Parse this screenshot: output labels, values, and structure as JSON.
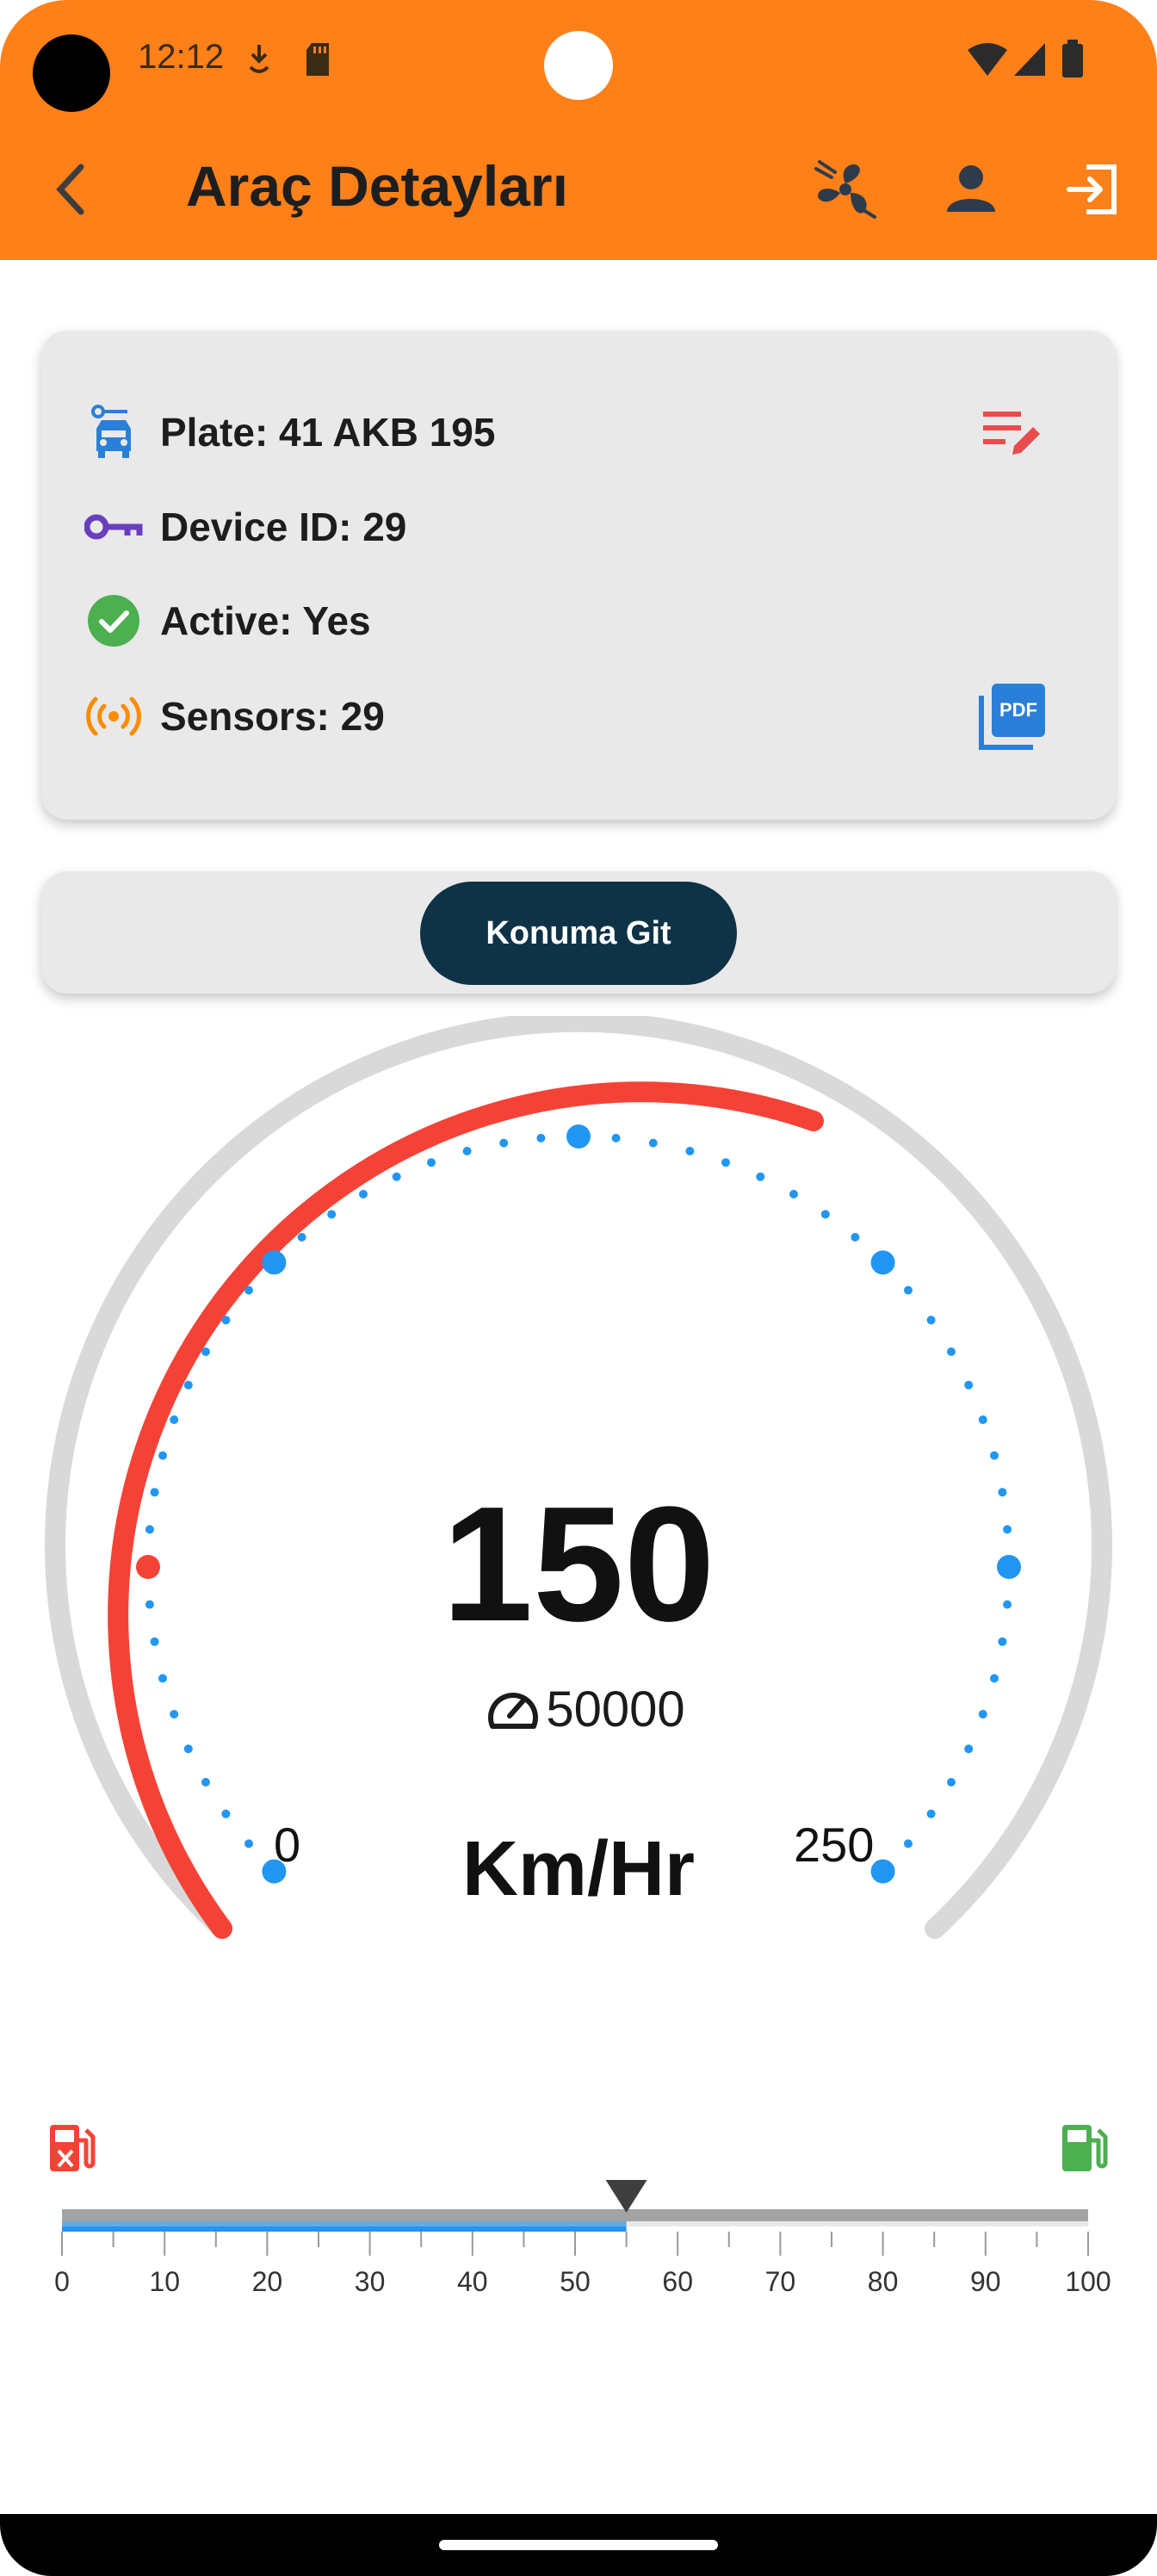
{
  "status_bar": {
    "time": "12:12"
  },
  "app_bar": {
    "title": "Araç Detayları",
    "icons": [
      "back-arrow-icon",
      "fan-icon",
      "person-icon",
      "logout-icon"
    ]
  },
  "vehicle_card": {
    "plate_label": "Plate: 41 AKB 195",
    "device_label": "Device ID: 29",
    "active_label": "Active: Yes",
    "sensors_label": "Sensors: 29",
    "pdf_icon_text": "PDF"
  },
  "location_button": {
    "label": "Konuma Git"
  },
  "gauge": {
    "speed": "150",
    "odometer": "50000",
    "unit": "Km/Hr",
    "min_label": "0",
    "max_label": "250",
    "min": 0,
    "max": 250,
    "value": 150,
    "colors": {
      "progress": "#f44336",
      "track": "#d9d9d9",
      "dots": "#2196f3",
      "active_dot": "#f44336"
    }
  },
  "fuel": {
    "level_percent": 55,
    "scale_labels": [
      "0",
      "10",
      "20",
      "30",
      "40",
      "50",
      "60",
      "70",
      "80",
      "90",
      "100"
    ],
    "colors": {
      "empty_icon": "#f44336",
      "full_icon": "#4caf50",
      "fill": "#2196f3",
      "track": "#a3a3a3"
    }
  }
}
